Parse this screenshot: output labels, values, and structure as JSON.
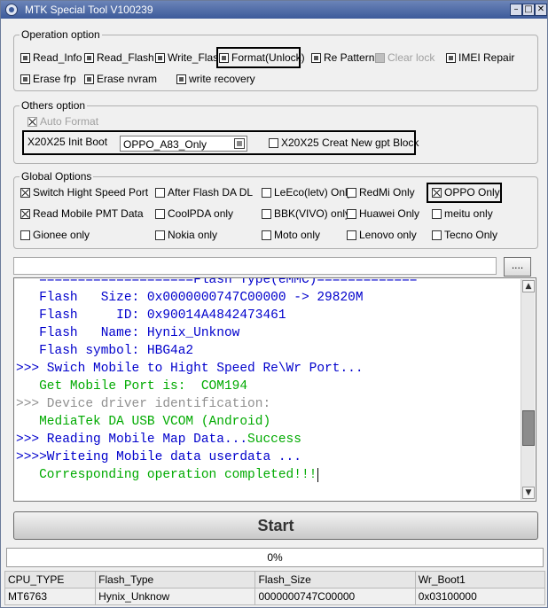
{
  "window": {
    "title": "MTK Special Tool V100239"
  },
  "operation": {
    "legend": "Operation option",
    "items": [
      {
        "label": "Read_Info",
        "checked": false
      },
      {
        "label": "Read_Flash",
        "checked": false
      },
      {
        "label": "Write_Flash",
        "checked": false
      },
      {
        "label": "Format(Unlock)",
        "checked": false
      },
      {
        "label": "Re Pattern lock",
        "checked": false
      },
      {
        "label": "Clear lock",
        "checked": false,
        "disabled": true
      },
      {
        "label": "IMEI Repair",
        "checked": false
      },
      {
        "label": "Erase frp",
        "checked": false
      },
      {
        "label": "Erase nvram",
        "checked": false
      },
      {
        "label": "write recovery",
        "checked": false
      }
    ]
  },
  "others": {
    "legend": "Others option",
    "auto_format": "Auto Format",
    "init_boot_label": "X20X25 Init Boot",
    "init_boot_value": "OPPO_A83_Only",
    "gpt_label": "X20X25 Creat New gpt Block"
  },
  "global": {
    "legend": "Global Options",
    "items": [
      {
        "label": "Switch Hight Speed Port",
        "checked": true
      },
      {
        "label": "After Flash DA DL",
        "checked": false
      },
      {
        "label": "LeEco(letv) Only",
        "checked": false
      },
      {
        "label": "RedMi Only",
        "checked": false
      },
      {
        "label": "OPPO Only",
        "checked": true
      },
      {
        "label": "Read Mobile PMT Data",
        "checked": true
      },
      {
        "label": "CoolPDA only",
        "checked": false
      },
      {
        "label": "BBK(VIVO) only",
        "checked": false
      },
      {
        "label": "Huawei Only",
        "checked": false
      },
      {
        "label": "meitu only",
        "checked": false
      },
      {
        "label": "Gionee only",
        "checked": false
      },
      {
        "label": "Nokia only",
        "checked": false
      },
      {
        "label": "Moto only",
        "checked": false
      },
      {
        "label": "Lenovo only",
        "checked": false
      },
      {
        "label": "Tecno Only",
        "checked": false
      }
    ]
  },
  "path_input": {
    "value": "",
    "browse_label": "...."
  },
  "log": {
    "lines": [
      {
        "text": "   ====================Flash Type(eMMC)=============",
        "color": "#0000cc"
      },
      {
        "text": "   Flash   Size: 0x0000000747C00000 -> 29820M",
        "color": "#0000cc"
      },
      {
        "text": "   Flash     ID: 0x90014A4842473461",
        "color": "#0000cc"
      },
      {
        "text": "   Flash   Name: Hynix_Unknow",
        "color": "#0000cc"
      },
      {
        "text": "   Flash symbol: HBG4a2",
        "color": "#0000cc"
      },
      {
        "text": ">>> Swich Mobile to Hight Speed Re\\Wr Port...",
        "color": "#0000cc"
      },
      {
        "text": "   Get Mobile Port is:  COM194",
        "color": "#00aa00"
      },
      {
        "text": ">>> Device driver identification:",
        "color": "#909090"
      },
      {
        "text": "   MediaTek DA USB VCOM (Android)",
        "color": "#00aa00"
      },
      {
        "text": ">>> Reading Mobile Map Data...",
        "color": "#0000cc",
        "suffix": "Success",
        "suffix_color": "#00aa00"
      },
      {
        "text": ">>>>Writeing Mobile data userdata ...",
        "color": "#0000cc"
      },
      {
        "text": "   Corresponding operation completed!!!",
        "color": "#00aa00"
      }
    ]
  },
  "start_label": "Start",
  "progress": {
    "text": "0%",
    "value": 0
  },
  "info_table": {
    "headers": [
      "CPU_TYPE",
      "Flash_Type",
      "Flash_Size",
      "Wr_Boot1"
    ],
    "row": [
      "MT6763",
      "Hynix_Unknow",
      "0000000747C00000",
      "0x03100000"
    ]
  }
}
